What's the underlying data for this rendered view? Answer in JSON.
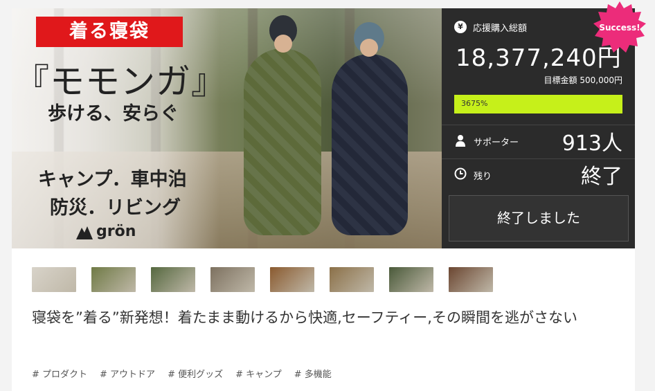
{
  "hero": {
    "badge": "着る寝袋",
    "title": "『モモンガ』",
    "subtitle": "歩ける、安らぐ",
    "line1": "キャンプ．車中泊",
    "line2": "防災．リビング",
    "logo": "grön"
  },
  "panel": {
    "total_label": "応援購入総額",
    "total_amount": "18,377,240円",
    "goal_label": "目標金額 500,000円",
    "progress_text": "3675%",
    "progress_fraction": 1.0,
    "supporters_label": "サポーター",
    "supporters_value": "913人",
    "remaining_label": "残り",
    "remaining_value": "終了",
    "end_button": "終了しました",
    "success_badge": "Success!"
  },
  "thumbnails": [
    {
      "name": "thumb-1",
      "color": "#d8d3c9"
    },
    {
      "name": "thumb-2",
      "color": "#6f7a45"
    },
    {
      "name": "thumb-3",
      "color": "#55683f"
    },
    {
      "name": "thumb-4",
      "color": "#7d7160"
    },
    {
      "name": "thumb-5",
      "color": "#8a5a2f"
    },
    {
      "name": "thumb-6",
      "color": "#8b7048"
    },
    {
      "name": "thumb-7",
      "color": "#4a5a3a"
    },
    {
      "name": "thumb-8",
      "color": "#6b4631"
    }
  ],
  "project_title": "寝袋を”着る”新発想！着たまま動けるから快適,セーフティー,その瞬間を逃がさない",
  "tags": [
    "# プロダクト",
    "# アウトドア",
    "# 便利グッズ",
    "# キャンプ",
    "# 多機能"
  ],
  "colors": {
    "panel_bg": "#2b2b2b",
    "progress": "#c6f01a",
    "badge_red": "#e0181b",
    "success_pink": "#ec2c7a"
  }
}
